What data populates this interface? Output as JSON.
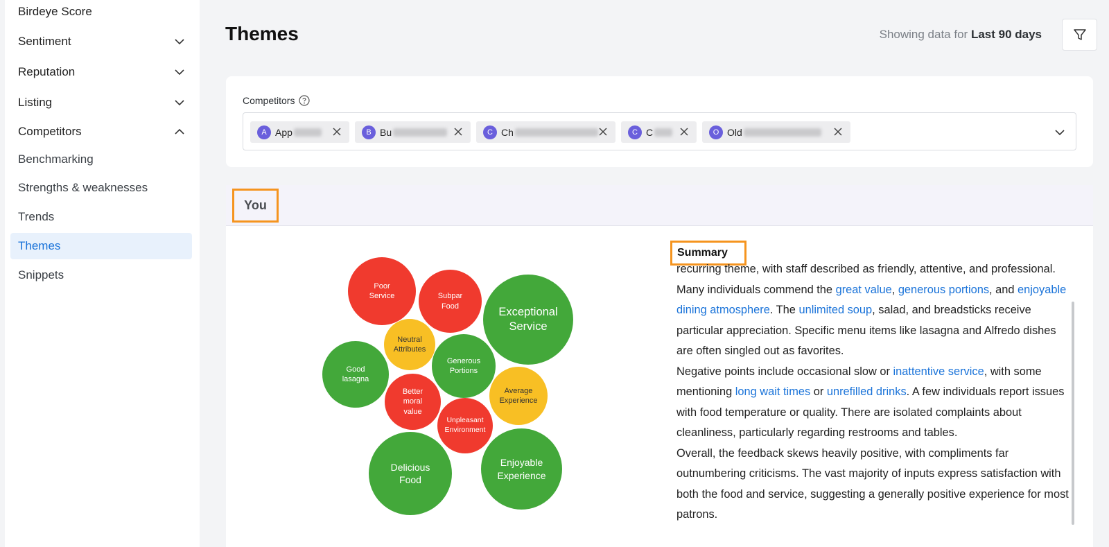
{
  "sidebar": {
    "items": [
      {
        "label": "Birdeye Score"
      },
      {
        "label": "Sentiment"
      },
      {
        "label": "Reputation"
      },
      {
        "label": "Listing"
      },
      {
        "label": "Competitors"
      }
    ],
    "competitors_sub": [
      {
        "label": "Benchmarking"
      },
      {
        "label": "Strengths & weaknesses"
      },
      {
        "label": "Trends"
      },
      {
        "label": "Themes",
        "active": true
      },
      {
        "label": "Snippets"
      }
    ]
  },
  "header": {
    "title": "Themes",
    "showing_prefix": "Showing data for",
    "showing_range": "Last 90 days"
  },
  "competitors": {
    "label": "Competitors",
    "chips": [
      {
        "initial": "A",
        "text": "App"
      },
      {
        "initial": "B",
        "text": "Bu"
      },
      {
        "initial": "C",
        "text": "Ch"
      },
      {
        "initial": "C",
        "text": "C"
      },
      {
        "initial": "O",
        "text": "Old"
      }
    ]
  },
  "you": {
    "label": "You"
  },
  "bubbles": [
    {
      "label": "Poor Service",
      "sentiment": "negative",
      "color": "#f03a2e"
    },
    {
      "label": "Subpar Food",
      "sentiment": "negative",
      "color": "#f03a2e"
    },
    {
      "label": "Exceptional Service",
      "sentiment": "positive",
      "color": "#43a83a"
    },
    {
      "label": "Neutral Attributes",
      "sentiment": "neutral",
      "color": "#f8bf24"
    },
    {
      "label": "Good lasagna",
      "sentiment": "positive",
      "color": "#43a83a"
    },
    {
      "label": "Generous Portions",
      "sentiment": "positive",
      "color": "#43a83a"
    },
    {
      "label": "Better moral value",
      "sentiment": "negative",
      "color": "#f03a2e"
    },
    {
      "label": "Average Experience",
      "sentiment": "neutral",
      "color": "#f8bf24"
    },
    {
      "label": "Unpleasant Environment",
      "sentiment": "negative",
      "color": "#f03a2e"
    },
    {
      "label": "Delicious Food",
      "sentiment": "positive",
      "color": "#43a83a"
    },
    {
      "label": "Enjoyable Experience",
      "sentiment": "positive",
      "color": "#43a83a"
    }
  ],
  "summary": {
    "title": "Summary",
    "p1": [
      {
        "t": "recurring theme, with staff described as friendly, attentive, and professional. Many individuals commend the "
      },
      {
        "t": "great value",
        "link": true
      },
      {
        "t": ", "
      },
      {
        "t": "generous portions",
        "link": true
      },
      {
        "t": ", and "
      },
      {
        "t": "enjoyable dining atmosphere",
        "link": true
      },
      {
        "t": ". The "
      },
      {
        "t": "unlimited soup",
        "link": true
      },
      {
        "t": ", salad, and breadsticks receive particular appreciation. Specific menu items like lasagna and Alfredo dishes are often singled out as favorites."
      }
    ],
    "p2": [
      {
        "t": "Negative points include occasional slow or "
      },
      {
        "t": "inattentive service",
        "link": true
      },
      {
        "t": ", with some mentioning "
      },
      {
        "t": "long wait times",
        "link": true
      },
      {
        "t": " or "
      },
      {
        "t": "unrefilled drinks",
        "link": true
      },
      {
        "t": ". A few individuals report issues with food temperature or quality. There are isolated complaints about cleanliness, particularly regarding restrooms and tables."
      }
    ],
    "p3": [
      {
        "t": "Overall, the feedback skews heavily positive, with compliments far outnumbering criticisms. The vast majority of inputs express satisfaction with both the food and service, suggesting a generally positive experience for most patrons."
      }
    ]
  }
}
